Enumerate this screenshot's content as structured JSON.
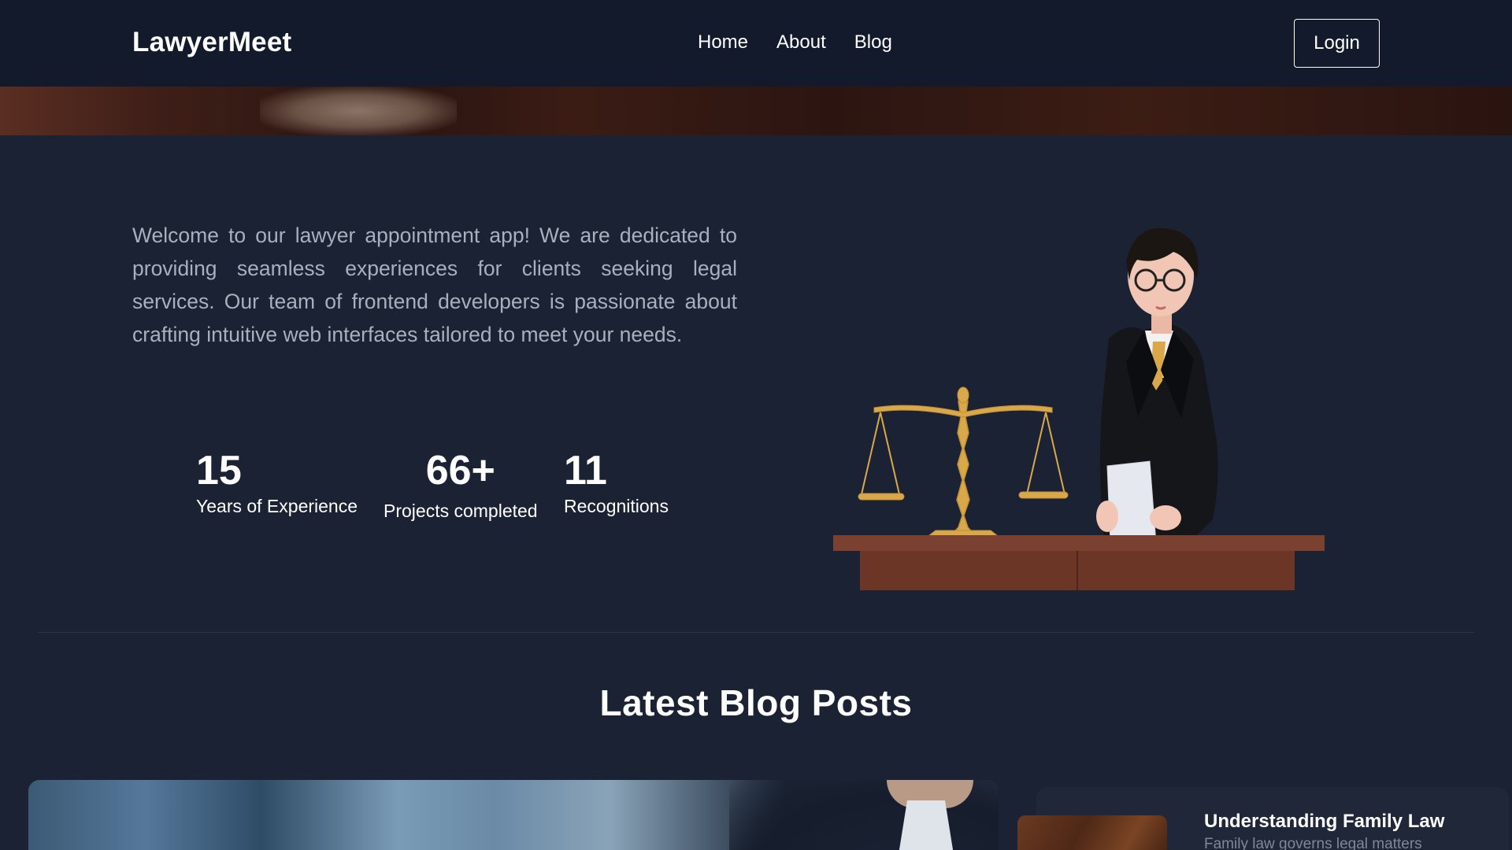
{
  "nav": {
    "brand": "LawyerMeet",
    "links": [
      "Home",
      "About",
      "Blog"
    ],
    "login_label": "Login"
  },
  "hero": {
    "intro": "Welcome to our lawyer appointment app! We are dedicated to providing seamless experiences for clients seeking legal services. Our team of frontend developers is passionate about crafting intuitive web interfaces tailored to meet your needs.",
    "stats": [
      {
        "number": "15",
        "label": "Years of Experience"
      },
      {
        "number": "66+",
        "label": "Projects completed"
      },
      {
        "number": "11",
        "label": "Recognitions"
      }
    ]
  },
  "blog": {
    "heading": "Latest Blog Posts",
    "side_post": {
      "title": "Understanding Family Law",
      "excerpt": "Family law governs legal matters"
    }
  },
  "colors": {
    "navbar_bg": "#121a2b",
    "page_bg": "#1b2233",
    "text_muted": "#a8b0be",
    "accent_gold": "#d9a84a",
    "desk_brown": "#6b3626"
  }
}
